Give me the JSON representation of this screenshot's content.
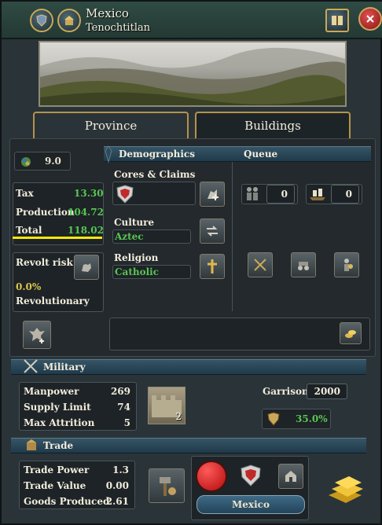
{
  "header": {
    "title": "Mexico",
    "subtitle": "Tenochtitlan"
  },
  "tabs": {
    "province": "Province",
    "buildings": "Buildings"
  },
  "development": {
    "value": "9.0"
  },
  "economy": {
    "tax_label": "Tax",
    "tax_value": "13.30",
    "production_label": "Production",
    "production_value": "104.72",
    "total_label": "Total",
    "total_value": "118.02"
  },
  "revolt": {
    "label": "Revolt risk",
    "value": "0.0%",
    "status": "Revolutionary"
  },
  "demographics": {
    "header": "Demographics",
    "cores_label": "Cores & Claims",
    "culture_label": "Culture",
    "culture_value": "Aztec",
    "religion_label": "Religion",
    "religion_value": "Catholic"
  },
  "queue": {
    "header": "Queue",
    "army_count": "0",
    "navy_count": "0"
  },
  "military": {
    "header": "Military",
    "manpower_label": "Manpower",
    "manpower_value": "269",
    "supply_label": "Supply Limit",
    "supply_value": "74",
    "attrition_label": "Max Attrition",
    "attrition_value": "5",
    "fort_level": "2",
    "garrison_label": "Garrison:",
    "garrison_value": "2000",
    "fort_defense": "35.0%"
  },
  "trade": {
    "header": "Trade",
    "power_label": "Trade Power",
    "power_value": "1.3",
    "value_label": "Trade Value",
    "value_value": "0.00",
    "goods_label": "Goods Produced",
    "goods_value": "2.61",
    "node_name": "Mexico"
  },
  "colors": {
    "positive": "#58c553",
    "highlight": "#f6e70a",
    "revolt": "#d9c64d"
  }
}
